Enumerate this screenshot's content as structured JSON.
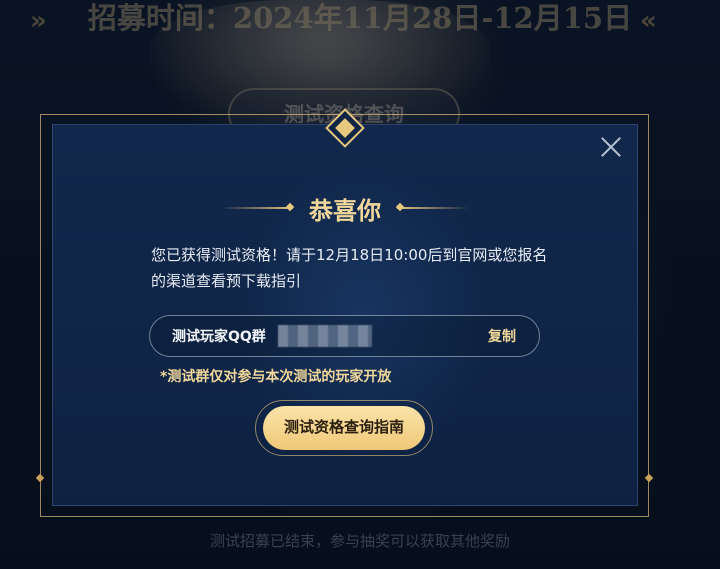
{
  "background": {
    "recruit_time": "招募时间：2024年11月28日-12月15日",
    "arrow_left": "»",
    "arrow_right": "«",
    "query_button_label": "测试资格查询",
    "footer_text": "测试招募已结束，参与抽奖可以获取其他奖励"
  },
  "modal": {
    "title": "恭喜你",
    "message": "您已获得测试资格！请于12月18日10:00后到官网或您报名的渠道查看预下载指引",
    "qq_label": "测试玩家QQ群",
    "copy_label": "复制",
    "note": "*测试群仅对参与本次测试的玩家开放",
    "guide_button_label": "测试资格查询指南"
  },
  "colors": {
    "accent_gold": "#f1d79a",
    "button_gold": "#f0c878",
    "modal_bg": "#11284c"
  }
}
